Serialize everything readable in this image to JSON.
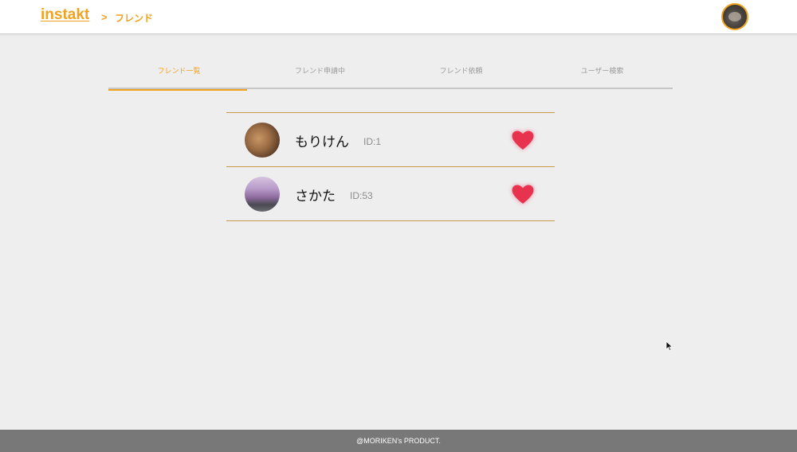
{
  "header": {
    "logo": "instakt",
    "breadcrumb_sep": ">",
    "breadcrumb_current": "フレンド"
  },
  "tabs": [
    {
      "label": "フレンド一覧",
      "active": true
    },
    {
      "label": "フレンド申請中",
      "active": false
    },
    {
      "label": "フレンド依頼",
      "active": false
    },
    {
      "label": "ユーザー検索",
      "active": false
    }
  ],
  "friends": [
    {
      "name": "もりけん",
      "id": "ID:1"
    },
    {
      "name": "さかた",
      "id": "ID:53"
    }
  ],
  "icons": {
    "heart": "heart-icon"
  },
  "colors": {
    "accent": "#f2a21e",
    "heart": "#e8334f",
    "footer_bg": "#787878",
    "page_bg": "#efeeef"
  },
  "footer": {
    "text": "@MORIKEN's PRODUCT."
  }
}
